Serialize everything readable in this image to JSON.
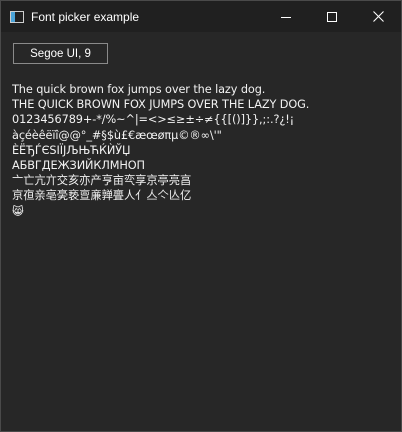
{
  "window": {
    "title": "Font picker example",
    "icon": "app-window-icon",
    "controls": [
      "minimize-icon",
      "maximize-icon",
      "close-icon"
    ]
  },
  "font_button": {
    "label": "Segoe UI, 9"
  },
  "sample_lines": [
    "The quick brown fox jumps over the lazy dog.",
    "THE QUICK BROWN FOX JUMPS OVER THE LAZY DOG.",
    "0123456789+-*/%~^|=<>≤≥±÷≠{{[()]}},;:.?¿!¡",
    "àçéèêëïî@@°_#§$ù£€æœøπµ©®∞\\'\"",
    "ÈЁЂЃЄЅІЇЈЉЊЋЌЍЎЏ",
    "АБВГДЕЖЗИЙКЛМНОП",
    "亠亡亢亣交亥亦产亨亩亪享京亭亮亯",
    "亰亱亲亳亴亵亶亷亸亹人亻亼亽亾亿",
    "😸"
  ],
  "colors": {
    "background": "#272727",
    "titlebar": "#202020",
    "text": "#ffffff",
    "button_border": "#8a8a8a"
  }
}
